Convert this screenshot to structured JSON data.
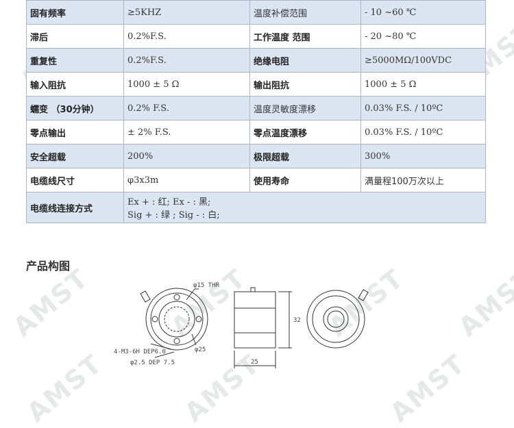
{
  "watermark": "AMST",
  "specs": [
    [
      {
        "k": "固有频率",
        "v": "≥5KHZ"
      },
      {
        "k": "温度补偿范围",
        "v": "- 10 ~60 ℃"
      }
    ],
    [
      {
        "k": "滞后",
        "v": "0.2%F.S."
      },
      {
        "k": "工作温度 范围",
        "v": "- 20 ~80 ℃"
      }
    ],
    [
      {
        "k": "重复性",
        "v": "0.2%F.S."
      },
      {
        "k": "绝缘电阻",
        "v": "≥5000MΩ/100VDC"
      }
    ],
    [
      {
        "k": "输入阻抗",
        "v": "1000 ± 5 Ω"
      },
      {
        "k": "输出阻抗",
        "v": "1000 ± 5 Ω"
      }
    ],
    [
      {
        "k": "蠕变 （30分钟）",
        "v": "0.2% F.S."
      },
      {
        "k": "温度灵敏度漂移",
        "v": "0.03% F.S. / 10ºC"
      }
    ],
    [
      {
        "k": "零点输出",
        "v": "± 2% F.S."
      },
      {
        "k": "零点温度漂移",
        "v": "0.03% F.S. / 10ºC"
      }
    ],
    [
      {
        "k": "安全超载",
        "v": "200%"
      },
      {
        "k": "极限超载",
        "v": "300%"
      }
    ],
    [
      {
        "k": "电缆线尺寸",
        "v": "φ3x3m"
      },
      {
        "k": "使用寿命",
        "v": "满量程100万次以上"
      }
    ]
  ],
  "wiring": {
    "label": "电缆线连接方式",
    "line1": "Ex + : 红;   Ex - : 黑;",
    "line2": "Sig + : 绿 ;  Sig - : 白;"
  },
  "section_title": "产品构图",
  "drawing": {
    "thread_note": "φ15 THR",
    "bolt_note": "4-M3-6H DEP6.0",
    "pin_note": "φ2.5 DEP 7.5",
    "pcd": "φ25",
    "height": "32",
    "width": "25"
  }
}
